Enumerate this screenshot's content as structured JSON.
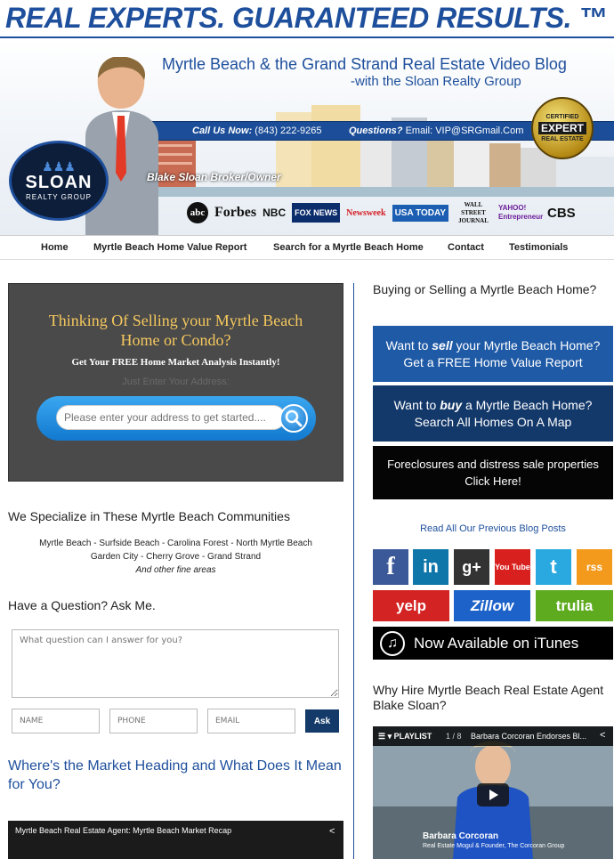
{
  "banner": {
    "tagline": "REAL EXPERTS. GUARANTEED RESULTS. ™",
    "blog_title": "Myrtle Beach & the Grand Strand Real Estate Video Blog",
    "blog_subtitle": "-with the Sloan Realty Group",
    "call_label": "Call Us Now:",
    "call_value": "(843) 222-9265",
    "questions_label": "Questions?",
    "questions_value": "Email: VIP@SRGmail.Com",
    "badge_top": "CERTIFIED",
    "badge_main": "EXPERT",
    "badge_bottom": "REAL ESTATE",
    "broker": "Blake Sloan Broker/Owner",
    "logo_name": "SLOAN",
    "logo_sub": "REALTY GROUP",
    "media": [
      "abc",
      "Forbes",
      "NBC",
      "FOX NEWS",
      "Newsweek",
      "USA TODAY",
      "WALL STREET JOURNAL",
      "YAHOO! Entrepreneur",
      "CBS"
    ]
  },
  "nav": {
    "items": [
      "Home",
      "Myrtle Beach Home Value Report",
      "Search for a Myrtle Beach Home",
      "Contact",
      "Testimonials"
    ]
  },
  "sell": {
    "heading_line1": "Thinking Of Selling your Myrtle Beach",
    "heading_line2": "Home or Condo?",
    "subheading": "Get Your FREE Home Market Analysis Instantly!",
    "hint": "Just Enter Your Address:",
    "address_placeholder": "Please enter your address to get started...."
  },
  "communities": {
    "heading": "We Specialize in These Myrtle Beach Communities",
    "line1": "Myrtle Beach - Surfside Beach - Carolina Forest - North Myrtle Beach",
    "line2": "Garden City - Cherry Grove - Grand Strand",
    "line3": "And other fine areas"
  },
  "ask": {
    "heading": "Have a Question? Ask Me.",
    "question_placeholder": "What question can I answer for you?",
    "name_placeholder": "NAME",
    "phone_placeholder": "PHONE",
    "email_placeholder": "EMAIL",
    "button": "Ask"
  },
  "market": {
    "heading": "Where's the Market Heading and What Does It Mean for You?",
    "video_title": "Myrtle Beach Real Estate Agent: Myrtle Beach Market Recap"
  },
  "sidebar": {
    "heading": "Buying or Selling a Myrtle Beach Home?",
    "cta1_pre": "Want to ",
    "cta1_em": "sell",
    "cta1_post": " your Myrtle Beach Home?",
    "cta1_line2": "Get a FREE Home Value Report",
    "cta2_pre": "Want to ",
    "cta2_em": "buy",
    "cta2_post": " a Myrtle Beach Home?",
    "cta2_line2": "Search All Homes On A Map",
    "cta3_line1": "Foreclosures and distress sale properties",
    "cta3_line2": "Click Here!",
    "read_all": "Read All Our Previous Blog Posts",
    "social": [
      {
        "icon": "facebook-icon",
        "glyph": "f",
        "color": "#3b5998"
      },
      {
        "icon": "linkedin-icon",
        "glyph": "in",
        "color": "#0e76a8"
      },
      {
        "icon": "google-plus-icon",
        "glyph": "g+",
        "color": "#333333"
      },
      {
        "icon": "youtube-icon",
        "glyph": "You Tube",
        "color": "#d8201e"
      },
      {
        "icon": "twitter-icon",
        "glyph": "t",
        "color": "#2aa9e0"
      },
      {
        "icon": "rss-icon",
        "glyph": "rss",
        "color": "#f39a1c"
      }
    ],
    "yelp": "yelp",
    "zillow": "Zillow",
    "trulia": "trulia",
    "itunes": "Now Available on iTunes",
    "why_heading": "Why Hire Myrtle Beach Real Estate Agent Blake Sloan?",
    "video_playlist": "PLAYLIST",
    "video_count": "1 / 8",
    "video_title": "Barbara Corcoran Endorses Bl...",
    "video_caption": "Barbara Corcoran",
    "video_caption2": "Real Estate Mogul & Founder, The Corcoran Group"
  }
}
